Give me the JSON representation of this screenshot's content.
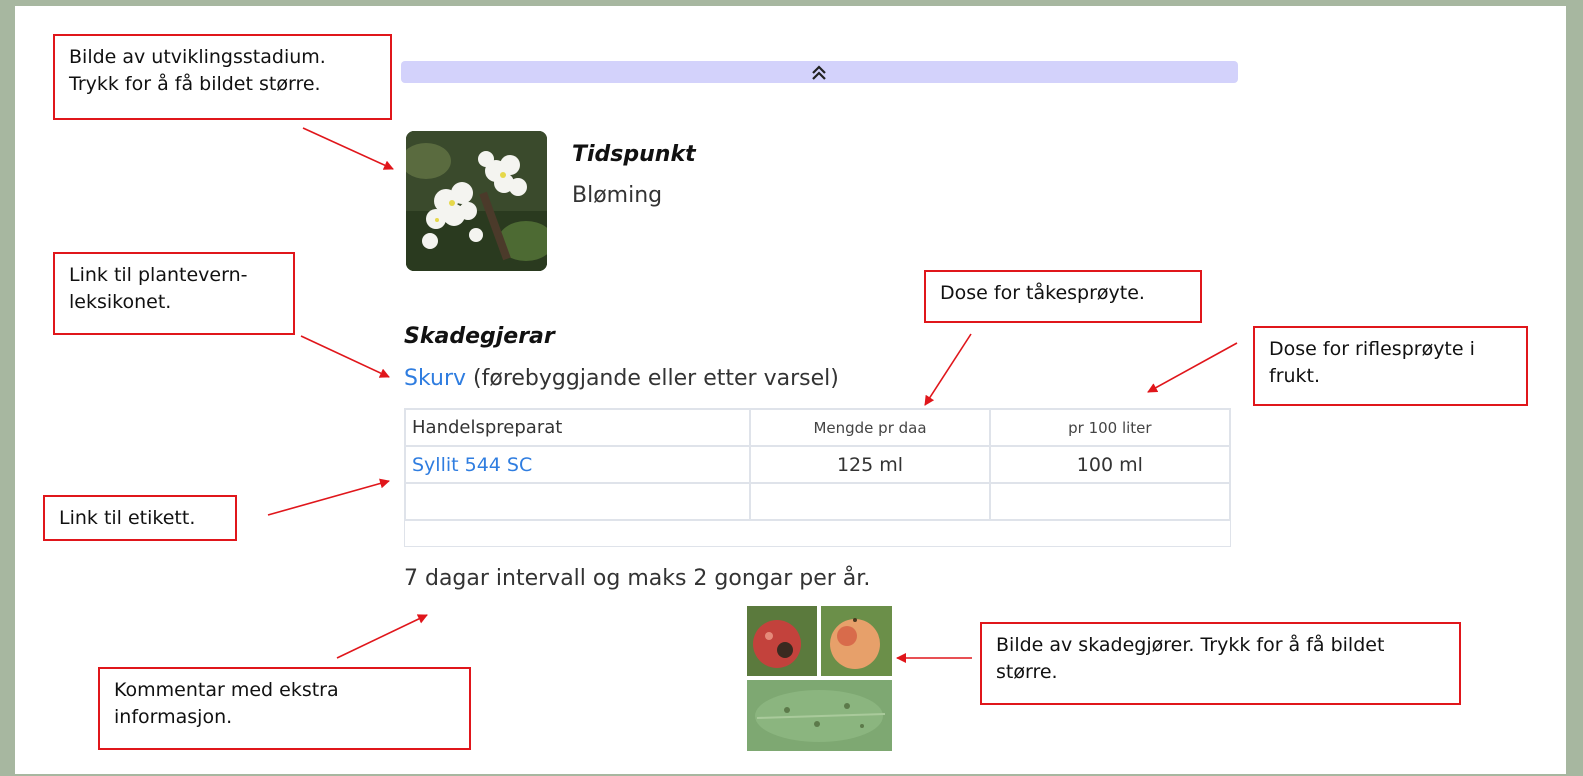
{
  "collapse": {
    "icon": "double-chevron-up-icon"
  },
  "stage": {
    "heading": "Tidspunkt",
    "value": "Bløming",
    "image_icon": "apple-blossom-photo"
  },
  "pest": {
    "heading": "Skadegjerar",
    "link": "Skurv",
    "note": " (førebyggjande eller etter varsel)"
  },
  "table": {
    "headers": [
      "Handelspreparat",
      "Mengde pr daa",
      "pr 100 liter"
    ],
    "rows": [
      [
        "Syllit 544 SC",
        "125 ml",
        "100 ml"
      ],
      [
        "",
        "",
        ""
      ]
    ]
  },
  "comment": "7 dagar intervall og maks 2 gongar per år.",
  "annotations": {
    "stage_image": [
      "Bilde av utviklingsstadium.",
      "Trykk for å få bildet større."
    ],
    "lexicon_link": [
      "Link til plantevern-",
      "leksikonet."
    ],
    "dose_fog": [
      "Dose for tåkesprøyte."
    ],
    "dose_rifle": [
      "Dose for riflesprøyte i",
      "frukt."
    ],
    "label_link": [
      "Link til etikett."
    ],
    "pest_image": [
      "Bilde av skadegjører. Trykk for å få bildet",
      "større."
    ],
    "comment": [
      "Kommentar med ekstra",
      "informasjon."
    ]
  },
  "colors": {
    "annotation_border": "#e0161b",
    "link": "#2f7de0",
    "collapse_bar": "#d3d2fb",
    "frame": "#a7b7a0"
  }
}
